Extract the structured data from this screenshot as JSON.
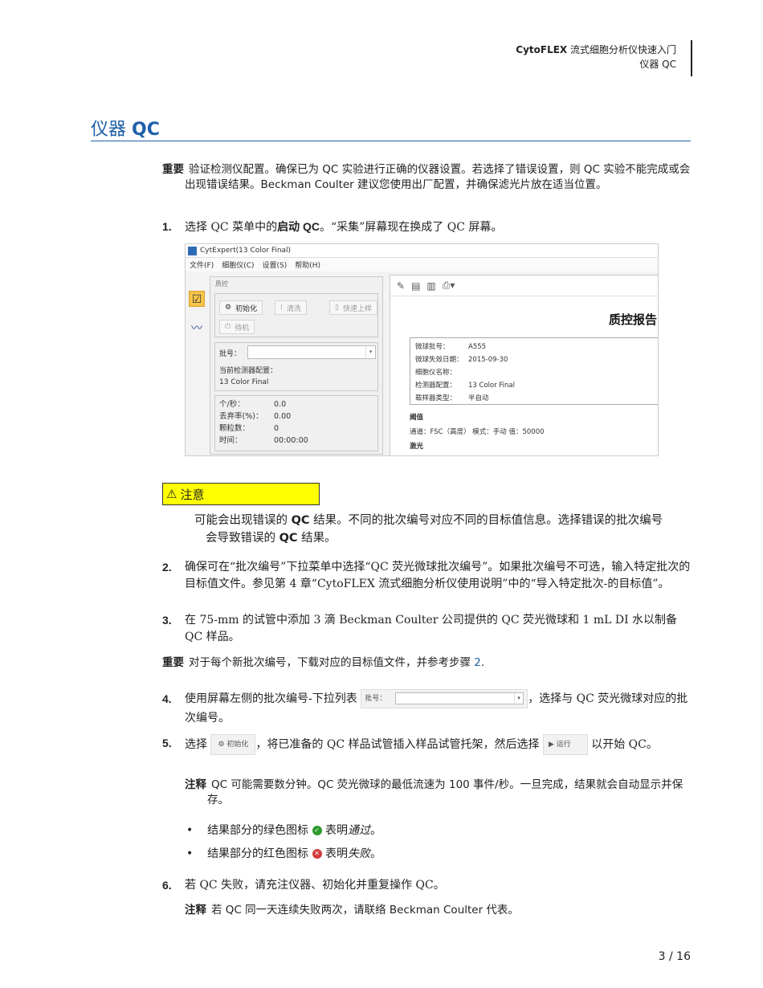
{
  "header": {
    "product": "CytoFLEX",
    "subtitle": " 流式细胞分析仪快速入门",
    "section": "仪器 QC"
  },
  "title": {
    "prefix": "仪器 ",
    "bold": "QC"
  },
  "important1": {
    "label": "重要",
    "text": "验证检测仪配置。确保已为 QC 实验进行正确的仪器设置。若选择了错误设置，则 QC 实验不能完成或会出现错误结果。Beckman Coulter 建议您使用出厂配置，并确保滤光片放在适当位置。"
  },
  "step1": {
    "num": "1.",
    "text_a": "选择 QC 菜单中的",
    "bold": "启动 QC",
    "text_b": "。“采集”屏幕现在换成了 QC 屏幕。"
  },
  "screenshot": {
    "window_title": "CytExpert(13 Color Final)",
    "menu": [
      "文件(F)",
      "细胞仪(C)",
      "设置(S)",
      "帮助(H)"
    ],
    "panel_title": "质控",
    "buttons": {
      "init": "初始化",
      "clean": "清洗",
      "fast": "快速上样",
      "standby": "待机"
    },
    "lot_label": "批号：",
    "detector_label": "当前检测器配置：",
    "detector_value": "13 Color Final",
    "stats": [
      {
        "k": "个/秒：",
        "v": "0.0"
      },
      {
        "k": "丢弃率(%)：",
        "v": "0.00"
      },
      {
        "k": "颗粒数：",
        "v": "0"
      },
      {
        "k": "时间：",
        "v": "00:00:00"
      }
    ],
    "report_title": "质控报告",
    "report_rows": [
      {
        "k": "微球批号：",
        "v": "A555"
      },
      {
        "k": "微球失效日期：",
        "v": "2015-09-30"
      },
      {
        "k": "细胞仪名称：",
        "v": ""
      },
      {
        "k": "检测器配置：",
        "v": "13 Color Final"
      },
      {
        "k": "载样器类型：",
        "v": "半自动"
      }
    ],
    "threshold_label": "阈值",
    "threshold_text": "通道：FSC（高度）  模式：手动  值：50000",
    "laser_label": "激光"
  },
  "caution": {
    "label": "注意",
    "text_a": "可能会出现错误的 ",
    "b1": "QC",
    "text_b": " 结果。不同的批次编号对应不同的目标值信息。选择错误的批次编号会导致错误的 ",
    "b2": "QC",
    "text_c": " 结果。"
  },
  "step2": {
    "num": "2.",
    "text": "确保可在“批次编号”下拉菜单中选择“QC 荧光微球批次编号”。如果批次编号不可选，输入特定批次的目标值文件。参见第 4 章“CytoFLEX 流式细胞分析仪使用说明”中的“导入特定批次-的目标值”。"
  },
  "step3": {
    "num": "3.",
    "text": "在 75-mm 的试管中添加 3 滴 Beckman Coulter 公司提供的 QC 荧光微球和 1 mL DI 水以制备 QC 样品。"
  },
  "important2": {
    "label": "重要",
    "text": "对于每个新批次编号，下载对应的目标值文件，并参考步骤 ",
    "link": "2",
    "end": "."
  },
  "step4": {
    "num": "4.",
    "text_a": "使用屏幕左侧的批次编号-下拉列表",
    "img_label": "批号：",
    "text_b": "，选择与 QC 荧光微球对应的批次编号。"
  },
  "step5": {
    "num": "5.",
    "text_a": "选择",
    "img_init": "初始化",
    "text_b": "，将已准备的 QC 样品试管插入样品试管托架，然后选择",
    "img_run": "运行",
    "text_c": "以开始 QC。"
  },
  "note1": {
    "label": "注释",
    "text": "QC 可能需要数分钟。QC 荧光微球的最低流速为 100 事件/秒。一旦完成，结果就会自动显示并保存。"
  },
  "bullets": [
    {
      "a": "结果部分的绿色图标",
      "b": "表明",
      "i": "通过",
      "c": "。",
      "color": "#2e9b2e"
    },
    {
      "a": "结果部分的红色图标",
      "b": "表明",
      "i": "失败",
      "c": "。",
      "color": "#d23a3a"
    }
  ],
  "step6": {
    "num": "6.",
    "text": "若 QC 失败，请充注仪器、初始化并重复操作 QC。"
  },
  "note2": {
    "label": "注释",
    "text": "若 QC 同一天连续失败两次，请联络 Beckman Coulter 代表。"
  },
  "page": "3 / 16"
}
